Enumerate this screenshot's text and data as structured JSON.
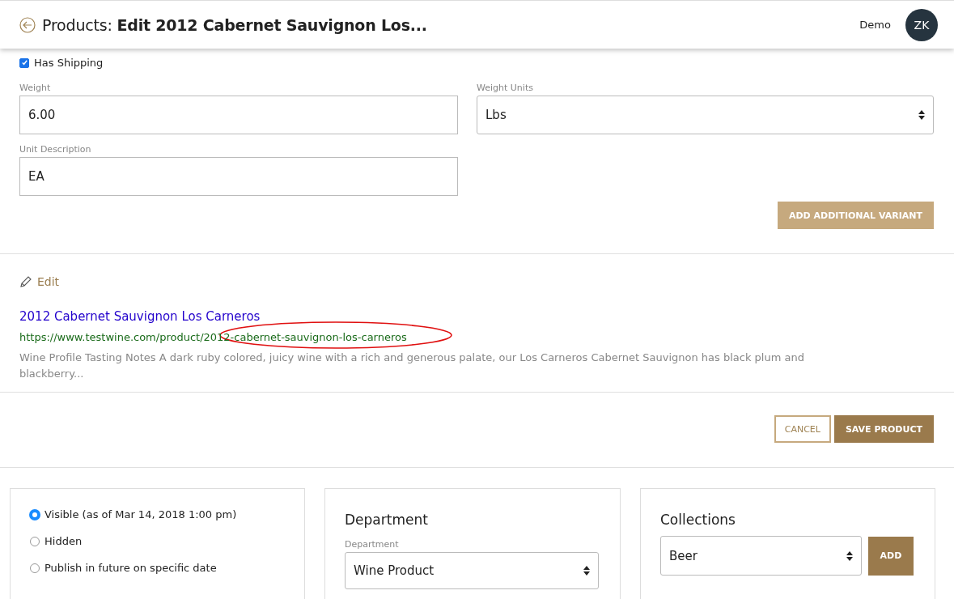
{
  "header": {
    "title_prefix": "Products:",
    "title": "Edit 2012 Cabernet Sauvignon Los...",
    "user": "Demo",
    "avatar": "ZK"
  },
  "shipping": {
    "label": "Has Shipping",
    "checked": true
  },
  "fields": [
    {
      "label": "Weight",
      "value": "6.00",
      "kind": "input"
    },
    {
      "label": "Weight Units",
      "value": "Lbs",
      "kind": "select"
    },
    {
      "label": "Unit Description",
      "value": "EA",
      "kind": "input"
    }
  ],
  "add_variant_button": "ADD ADDITIONAL VARIANT",
  "seo": {
    "edit_label": "Edit",
    "title": "2012 Cabernet Sauvignon Los Carneros",
    "url": "https://www.testwine.com/product/2012-cabernet-sauvignon-los-carneros",
    "description": "Wine Profile Tasting Notes A dark ruby colored, juicy wine with a rich and generous palate, our Los Carneros Cabernet Sauvignon has black plum and blackberry..."
  },
  "actions": [
    {
      "label": "CANCEL",
      "kind": "outline"
    },
    {
      "label": "SAVE PRODUCT",
      "kind": "primary"
    }
  ],
  "visibility": [
    {
      "label": "Visible (as of Mar 14, 2018 1:00 pm)",
      "selected": true
    },
    {
      "label": "Hidden",
      "selected": false
    },
    {
      "label": "Publish in future on specific date",
      "selected": false
    }
  ],
  "department": {
    "heading": "Department",
    "label": "Department",
    "value": "Wine Product"
  },
  "collections": {
    "heading": "Collections",
    "value": "Beer",
    "button": "ADD"
  }
}
